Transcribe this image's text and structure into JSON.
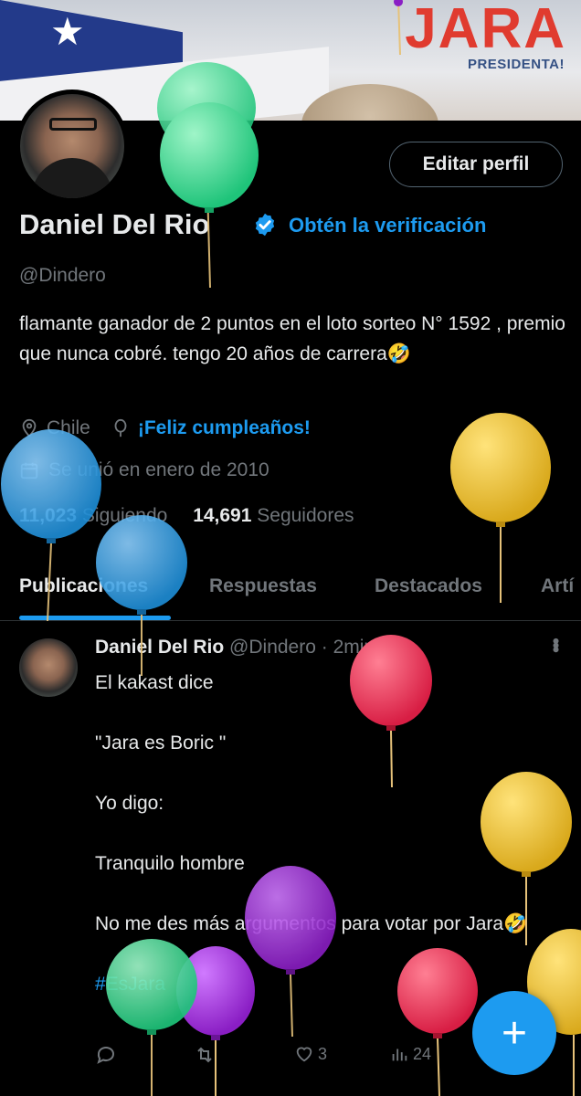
{
  "banner": {
    "headline": "JARA",
    "subline": "PRESIDENTA!"
  },
  "profile": {
    "edit_button": "Editar perfil",
    "name": "Daniel Del Rio",
    "get_verified": "Obtén la verificación",
    "handle": "@Dindero",
    "bio": "flamante ganador de 2 puntos en el loto sorteo N° 1592 , premio que nunca  cobré.  tengo 20 años de carrera🤣",
    "location": "Chile",
    "birthday": "¡Feliz cumpleaños!",
    "joined": "Se unió en enero de 2010",
    "following_count": "11,023",
    "following_label": "Siguiendo",
    "followers_count": "14,691",
    "followers_label": "Seguidores"
  },
  "tabs": [
    {
      "label": "Publicaciones"
    },
    {
      "label": "Respuestas"
    },
    {
      "label": "Destacados"
    },
    {
      "label": "Artí"
    }
  ],
  "tweet": {
    "name": "Daniel Del Rio",
    "handle": "@Dindero",
    "time": "· 2min",
    "lines": [
      "El kakast dice",
      "\"Jara es Boric \"",
      "Yo digo:",
      "Tranquilo hombre",
      "No me des más argumentos para votar por Jara🤣",
      "#EsJara"
    ],
    "likes": "3",
    "views": "24"
  },
  "colors": {
    "accent": "#1d9bf0",
    "muted": "#71767b",
    "text": "#e7e9ea",
    "background": "#000000"
  },
  "icons": {
    "verified": "verified-badge-icon",
    "location": "location-pin-icon",
    "birthday": "balloon-icon",
    "calendar": "calendar-icon",
    "reply": "reply-icon",
    "retweet": "retweet-icon",
    "like": "heart-icon",
    "views": "views-chart-icon",
    "more": "more-vertical-icon",
    "compose": "plus-icon"
  }
}
